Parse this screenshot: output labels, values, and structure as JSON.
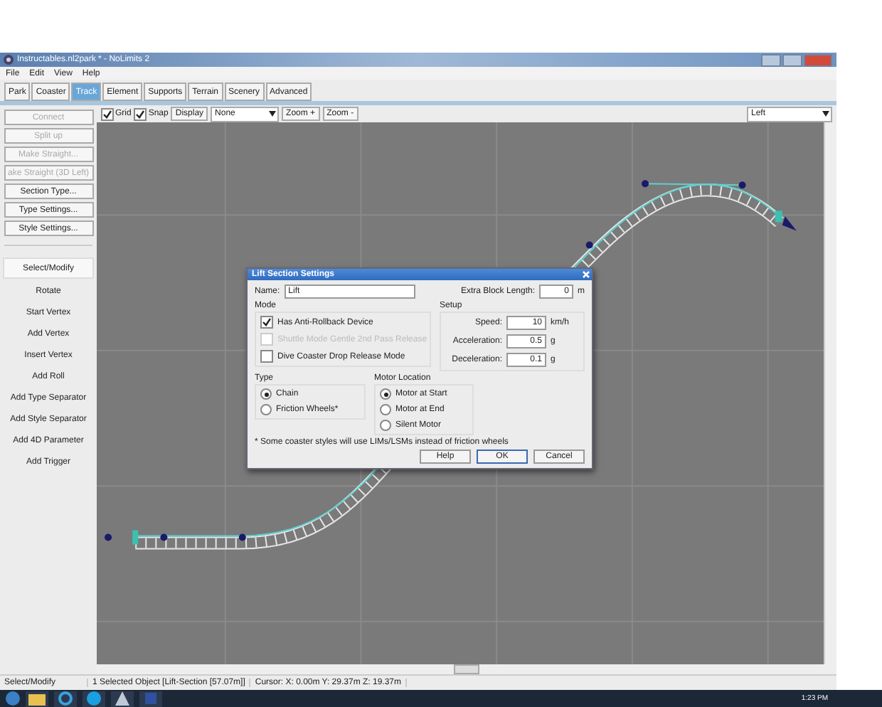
{
  "window": {
    "title": "Instructables.nl2park * - NoLimits 2"
  },
  "menu": [
    "File",
    "Edit",
    "View",
    "Help"
  ],
  "tabs": [
    {
      "label": "Park",
      "selected": false
    },
    {
      "label": "Coaster",
      "selected": false
    },
    {
      "label": "Track",
      "selected": true
    },
    {
      "label": "Element",
      "selected": false
    },
    {
      "label": "Supports",
      "selected": false
    },
    {
      "label": "Terrain",
      "selected": false
    },
    {
      "label": "Scenery",
      "selected": false
    },
    {
      "label": "Advanced",
      "selected": false
    }
  ],
  "toolbar": {
    "toggles": [
      {
        "label": "Grid",
        "checked": true
      },
      {
        "label": "Snap",
        "checked": true
      }
    ],
    "display_button": "Display",
    "display_select": "None",
    "zoom_buttons": [
      "Zoom +",
      "Zoom -"
    ],
    "view_select": "Left"
  },
  "left_panel": {
    "actions": [
      {
        "label": "Connect",
        "disabled": true
      },
      {
        "label": "Split up",
        "disabled": true
      },
      {
        "label": "Make Straight...",
        "disabled": true
      },
      {
        "label": "ake Straight (3D Left)",
        "disabled": true
      },
      {
        "label": "Section Type...",
        "disabled": false
      },
      {
        "label": "Type Settings...",
        "disabled": false
      },
      {
        "label": "Style Settings...",
        "disabled": false
      }
    ],
    "tools": [
      {
        "label": "Select/Modify",
        "selected": true
      },
      {
        "label": "Rotate",
        "selected": false
      },
      {
        "label": "Start Vertex",
        "selected": false
      },
      {
        "label": "Add Vertex",
        "selected": false
      },
      {
        "label": "Insert Vertex",
        "selected": false
      },
      {
        "label": "Add Roll",
        "selected": false
      },
      {
        "label": "Add Type Separator",
        "selected": false
      },
      {
        "label": "Add Style Separator",
        "selected": false
      },
      {
        "label": "Add 4D Parameter",
        "selected": false
      },
      {
        "label": "Add Trigger",
        "selected": false
      }
    ]
  },
  "dialog": {
    "title": "Lift Section Settings",
    "name_label": "Name:",
    "name_value": "Lift",
    "extra_label": "Extra Block Length:",
    "extra_value": "0",
    "extra_unit": "m",
    "mode": {
      "title": "Mode",
      "options": [
        {
          "label": "Has Anti-Rollback Device",
          "checked": true,
          "disabled": false
        },
        {
          "label": "Shuttle Mode Gentle 2nd Pass Release",
          "checked": false,
          "disabled": true
        },
        {
          "label": "Dive Coaster Drop Release Mode",
          "checked": false,
          "disabled": false
        }
      ]
    },
    "setup": {
      "title": "Setup",
      "rows": [
        {
          "label": "Speed:",
          "value": "10",
          "unit": "km/h"
        },
        {
          "label": "Acceleration:",
          "value": "0.5",
          "unit": "g"
        },
        {
          "label": "Deceleration:",
          "value": "0.1",
          "unit": "g"
        }
      ]
    },
    "type": {
      "title": "Type",
      "options": [
        {
          "label": "Chain",
          "selected": true
        },
        {
          "label": "Friction Wheels*",
          "selected": false
        }
      ]
    },
    "motor": {
      "title": "Motor Location",
      "options": [
        {
          "label": "Motor at Start",
          "selected": true
        },
        {
          "label": "Motor at End",
          "selected": false
        },
        {
          "label": "Silent Motor",
          "selected": false
        }
      ]
    },
    "note": "* Some coaster styles will use LIMs/LSMs instead of friction wheels",
    "buttons": [
      {
        "label": "Help",
        "default": false
      },
      {
        "label": "OK",
        "default": true
      },
      {
        "label": "Cancel",
        "default": false
      }
    ]
  },
  "status_bar": [
    "Select/Modify",
    "1 Selected Object [Lift-Section [57.07m]]",
    "Cursor: X: 0.00m Y: 29.37m Z: 19.37m"
  ],
  "taskbar": {
    "time": "1:23 PM"
  }
}
